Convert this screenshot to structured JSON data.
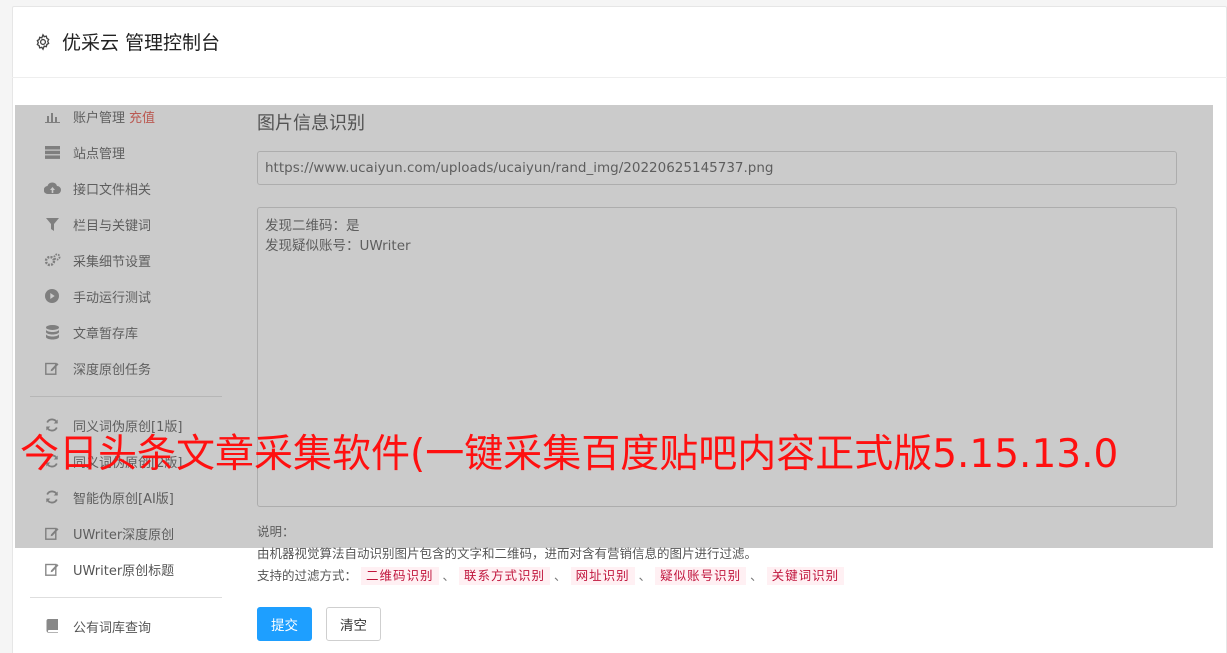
{
  "header": {
    "title": "优采云 管理控制台",
    "icon": "gear-icon"
  },
  "sidebar": {
    "items": [
      {
        "label": "账户管理",
        "extra": "充值",
        "icon": "bar-chart-icon"
      },
      {
        "label": "站点管理",
        "icon": "server-icon"
      },
      {
        "label": "接口文件相关",
        "icon": "cloud-upload-icon"
      },
      {
        "label": "栏目与关键词",
        "icon": "filter-icon"
      },
      {
        "label": "采集细节设置",
        "icon": "cogs-icon"
      },
      {
        "label": "手动运行测试",
        "icon": "play-circle-icon"
      },
      {
        "label": "文章暂存库",
        "icon": "database-icon"
      },
      {
        "label": "深度原创任务",
        "icon": "edit-icon"
      }
    ],
    "items2": [
      {
        "label": "同义词伪原创[1版]",
        "icon": "refresh-icon"
      },
      {
        "label": "同义词伪原创[2版]",
        "icon": "refresh-icon"
      },
      {
        "label": "智能伪原创[AI版]",
        "icon": "refresh-icon"
      },
      {
        "label": "UWriter深度原创",
        "icon": "edit-icon"
      },
      {
        "label": "UWriter原创标题",
        "icon": "edit-icon"
      }
    ],
    "items3": [
      {
        "label": "公有词库查询",
        "icon": "book-icon"
      }
    ]
  },
  "main": {
    "title": "图片信息识别",
    "url_value": "https://www.ucaiyun.com/uploads/ucaiyun/rand_img/20220625145737.png",
    "result_lines": [
      "发现二维码：是",
      "发现疑似账号：UWriter"
    ],
    "desc_label": "说明：",
    "desc_text": "由机器视觉算法自动识别图片包含的文字和二维码，进而对含有营销信息的图片进行过滤。",
    "filter_label": "支持的过滤方式：",
    "filter_tags": [
      "二维码识别",
      "联系方式识别",
      "网址识别",
      "疑似账号识别",
      "关键词识别"
    ],
    "separator": "、",
    "submit_label": "提交",
    "clear_label": "清空"
  },
  "watermark": "今日头条文章采集软件(一键采集百度贴吧内容正式版5.15.13.0",
  "colors": {
    "primary": "#1e9fff",
    "recharge": "#e54d42",
    "tag_text": "#c0143c",
    "watermark": "#ff1010"
  }
}
